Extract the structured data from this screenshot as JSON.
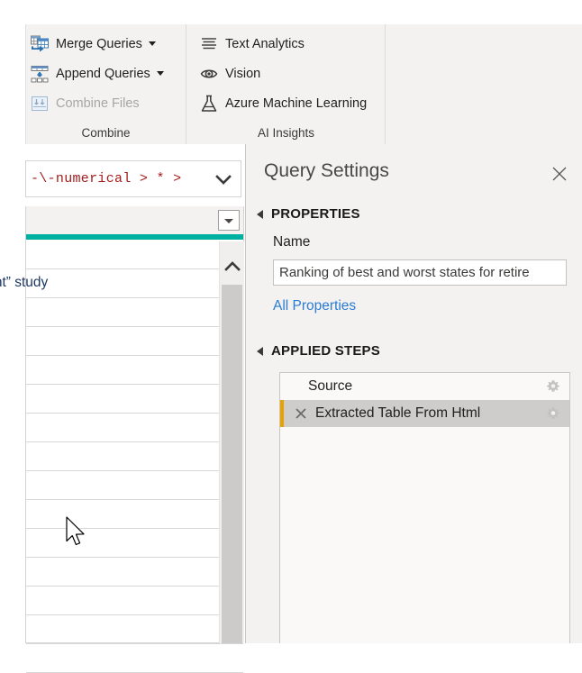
{
  "app": "Power Query Editor",
  "ribbon": {
    "groups": [
      {
        "name": "combine",
        "label": "Combine",
        "items": [
          {
            "label": "Merge Queries",
            "icon": "merge-queries-icon",
            "has_caret": true,
            "disabled": false
          },
          {
            "label": "Append Queries",
            "icon": "append-queries-icon",
            "has_caret": true,
            "disabled": false
          },
          {
            "label": "Combine Files",
            "icon": "combine-files-icon",
            "has_caret": false,
            "disabled": true
          }
        ]
      },
      {
        "name": "ai-insights",
        "label": "AI Insights",
        "items": [
          {
            "label": "Text Analytics",
            "icon": "text-analytics-icon",
            "has_caret": false,
            "disabled": false
          },
          {
            "label": "Vision",
            "icon": "vision-eye-icon",
            "has_caret": false,
            "disabled": false
          },
          {
            "label": "Azure Machine Learning",
            "icon": "azure-ml-flask-icon",
            "has_caret": false,
            "disabled": false
          }
        ]
      }
    ]
  },
  "formula_bar": {
    "value": "-\\-numerical > * >",
    "expand_icon": "chevron-down-icon"
  },
  "grid": {
    "filter_icon": "filter-dropdown-icon",
    "scroll_up_icon": "chevron-up-icon",
    "rows": [
      {
        "value": ""
      },
      {
        "value": "ates for retirement” study"
      },
      {
        "value": ""
      },
      {
        "value": ""
      },
      {
        "value": ""
      },
      {
        "value": ""
      },
      {
        "value": ""
      },
      {
        "value": ""
      },
      {
        "value": ""
      },
      {
        "value": ""
      },
      {
        "value": ""
      },
      {
        "value": ""
      },
      {
        "value": ""
      },
      {
        "value": ""
      },
      {
        "value": ""
      }
    ]
  },
  "query_settings": {
    "title": "Query Settings",
    "close_icon": "close-icon",
    "properties": {
      "header": "PROPERTIES",
      "name_label": "Name",
      "name_value": "Ranking of best and worst states for retire",
      "all_properties_link": "All Properties"
    },
    "applied_steps": {
      "header": "APPLIED STEPS",
      "steps": [
        {
          "label": "Source",
          "selected": false,
          "has_delete": false,
          "gear_icon": "gear-icon"
        },
        {
          "label": "Extracted Table From Html",
          "selected": true,
          "has_delete": true,
          "delete_icon": "close-icon",
          "gear_icon": "gear-icon"
        }
      ]
    }
  },
  "cursor": {
    "icon": "mouse-pointer-cursor"
  },
  "colors": {
    "ribbon_bg": "#f3f2f1",
    "teal_header": "#00b0a0",
    "link_blue": "#2b7cd3",
    "formula_red": "#a41d1d",
    "step_marker": "#e8a200",
    "selected_step": "#cfcdcb",
    "cell_text": "#1f3864"
  }
}
